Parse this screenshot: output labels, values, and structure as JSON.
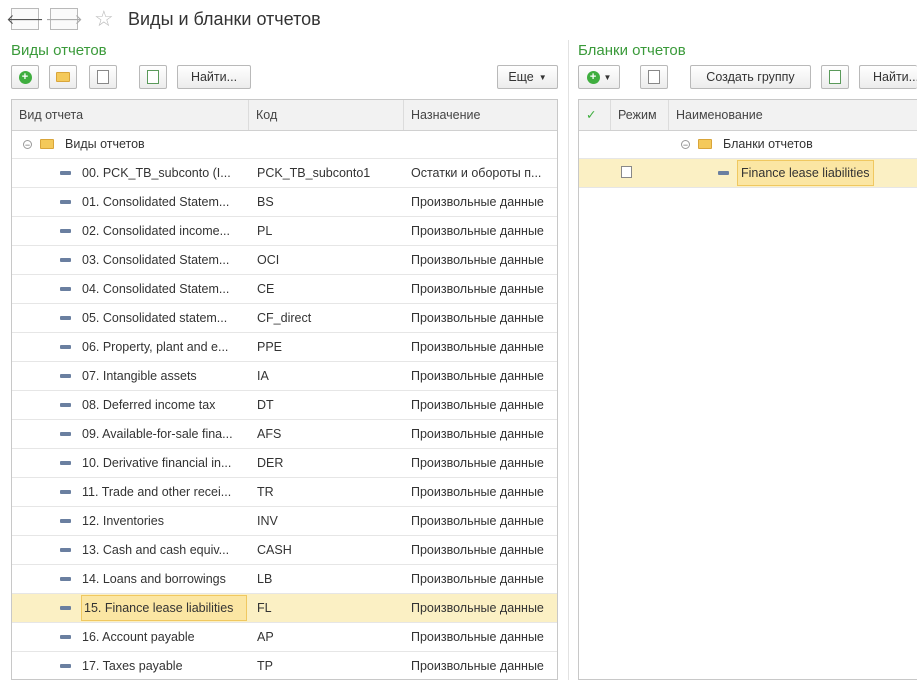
{
  "window": {
    "title": "Виды и бланки отчетов"
  },
  "left": {
    "title": "Виды отчетов",
    "find_label": "Найти...",
    "more_label": "Еще",
    "columns": [
      "Вид отчета",
      "Код",
      "Назначение"
    ],
    "group_label": "Виды отчетов",
    "rows": [
      {
        "name": "00. PCK_TB_subconto (I...",
        "code": "PCK_TB_subconto1",
        "purpose": "Остатки и обороты п..."
      },
      {
        "name": "01. Consolidated Statem...",
        "code": "BS",
        "purpose": "Произвольные данные"
      },
      {
        "name": "02. Consolidated income...",
        "code": "PL",
        "purpose": "Произвольные данные"
      },
      {
        "name": "03. Consolidated Statem...",
        "code": "OCI",
        "purpose": "Произвольные данные"
      },
      {
        "name": "04. Consolidated Statem...",
        "code": "CE",
        "purpose": "Произвольные данные"
      },
      {
        "name": "05. Consolidated statem...",
        "code": "CF_direct",
        "purpose": "Произвольные данные"
      },
      {
        "name": "06. Property, plant and e...",
        "code": "PPE",
        "purpose": "Произвольные данные"
      },
      {
        "name": "07. Intangible assets",
        "code": "IA",
        "purpose": "Произвольные данные"
      },
      {
        "name": "08. Deferred income tax",
        "code": "DT",
        "purpose": "Произвольные данные"
      },
      {
        "name": "09. Available-for-sale fina...",
        "code": "AFS",
        "purpose": "Произвольные данные"
      },
      {
        "name": "10. Derivative financial in...",
        "code": "DER",
        "purpose": "Произвольные данные"
      },
      {
        "name": "11. Trade and other recei...",
        "code": "TR",
        "purpose": "Произвольные данные"
      },
      {
        "name": "12. Inventories",
        "code": "INV",
        "purpose": "Произвольные данные"
      },
      {
        "name": "13. Cash and cash equiv...",
        "code": "CASH",
        "purpose": "Произвольные данные"
      },
      {
        "name": "14. Loans and borrowings",
        "code": "LB",
        "purpose": "Произвольные данные"
      },
      {
        "name": "15. Finance lease liabilities",
        "code": "FL",
        "purpose": "Произвольные данные"
      },
      {
        "name": "16. Account payable",
        "code": "AP",
        "purpose": "Произвольные данные"
      },
      {
        "name": "17. Taxes payable",
        "code": "TP",
        "purpose": "Произвольные данные"
      }
    ]
  },
  "right": {
    "title": "Бланки отчетов",
    "create_group_label": "Создать группу",
    "find_label": "Найти...",
    "columns": [
      "✓",
      "Режим",
      "Наименование"
    ],
    "group_label": "Бланки отчетов",
    "row_name": "Finance lease liabilities"
  },
  "colors": {
    "accent_green": "#3a9a3a",
    "selection": "#fbf0c4"
  }
}
